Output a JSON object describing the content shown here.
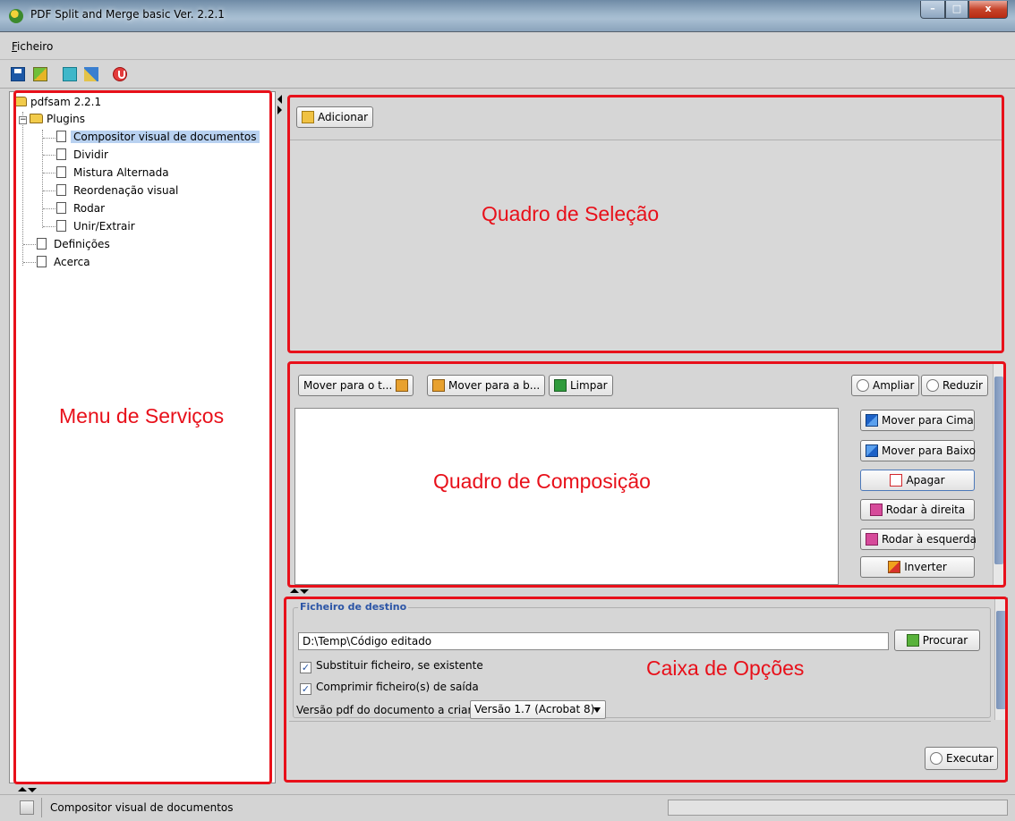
{
  "window": {
    "title": "PDF Split and Merge basic Ver. 2.2.1",
    "minimize_label": "–",
    "maximize_label": "□",
    "close_label": "x"
  },
  "menu": {
    "file": "Ficheiro"
  },
  "tree": {
    "root": "pdfsam 2.2.1",
    "plugins_folder": "Plugins",
    "plugins_expander": "−",
    "plugins": [
      "Compositor visual de documentos",
      "Dividir",
      "Mistura Alternada",
      "Reordenação visual",
      "Rodar",
      "Unir/Extrair"
    ],
    "settings": "Definições",
    "about": "Acerca",
    "selected": "Compositor visual de documentos"
  },
  "selection": {
    "add_button": "Adicionar"
  },
  "composition": {
    "move_top_button": "Mover para o t...",
    "move_bottom_button": "Mover para a b...",
    "clear_button": "Limpar",
    "zoom_in_button": "Ampliar",
    "zoom_out_button": "Reduzir",
    "move_up_button": "Mover para Cima",
    "move_down_button": "Mover para Baixo",
    "delete_button": "Apagar",
    "rotate_right_button": "Rodar à direita",
    "rotate_left_button": "Rodar à esquerda",
    "invert_button": "Inverter"
  },
  "options": {
    "legend": "Ficheiro de destino",
    "destination_value": "D:\\Temp\\Código editado",
    "browse_button": "Procurar",
    "overwrite_label": "Substituir ficheiro, se existente",
    "overwrite_checked": true,
    "compress_label": "Comprimir ficheiro(s) de saída",
    "compress_checked": true,
    "version_label": "Versão pdf do documento a criar:",
    "version_value": "Versão 1.7 (Acrobat 8)",
    "run_button": "Executar",
    "check_mark": "✓"
  },
  "annotations": {
    "services_menu": "Menu de Serviços",
    "selection_frame": "Quadro de Seleção",
    "composition_frame": "Quadro de Composição",
    "options_box": "Caixa de Opções",
    "color": "#e8101a"
  },
  "status": {
    "text": "Compositor visual de documentos"
  }
}
